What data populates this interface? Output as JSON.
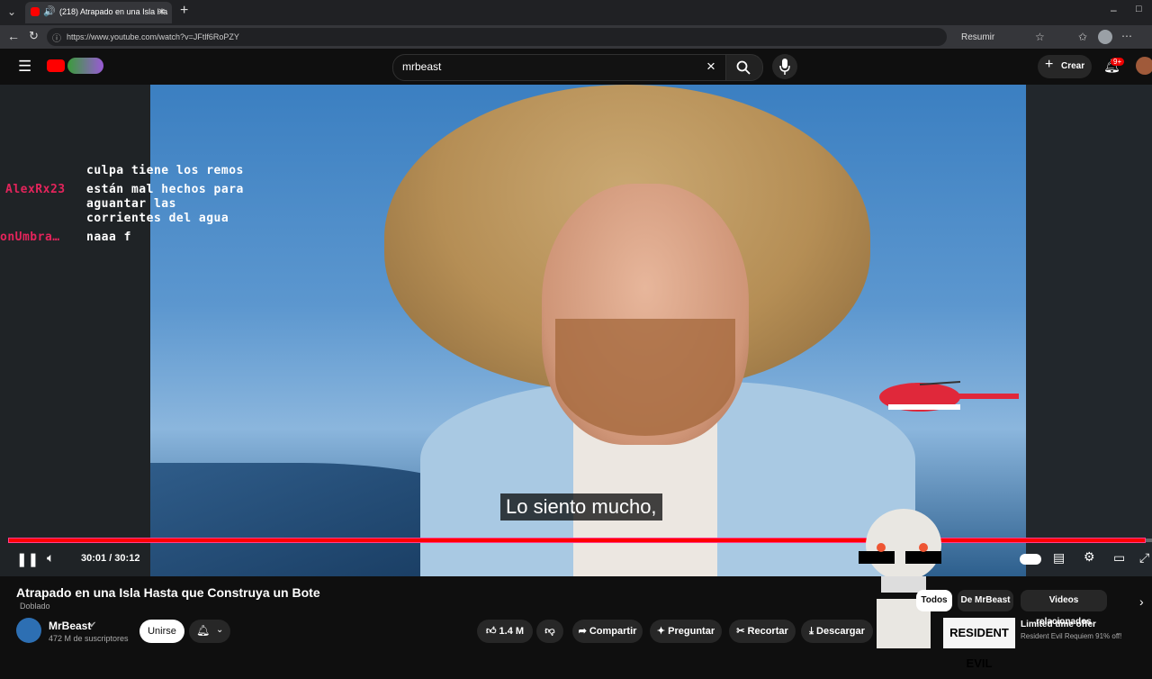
{
  "browser": {
    "tab_title": "(218) Atrapado en una Isla Ha",
    "url": "https://www.youtube.com/watch?v=JFtlf6RoPZY",
    "resumir_label": "Resumir"
  },
  "header": {
    "search_value": "mrbeast",
    "create_label": "Crear",
    "notifications_badge": "9+"
  },
  "player": {
    "chat": [
      {
        "name": "",
        "text": "culpa tiene los remos"
      },
      {
        "name": "AlexRx23",
        "text": "están mal hechos para"
      },
      {
        "name": "",
        "text": "aguantar las"
      },
      {
        "name": "",
        "text": "corrientes del agua"
      },
      {
        "name": "onUmbra…",
        "text": "naaa f"
      }
    ],
    "subtitle": "Lo siento mucho,",
    "time": "30:01 / 30:12",
    "progress_fraction": 0.994
  },
  "video": {
    "title": "Atrapado en una Isla Hasta que Construya un Bote",
    "dub_label": "Doblado",
    "channel": "MrBeast",
    "subscribers": "472 M de suscriptores",
    "join_label": "Unirse",
    "likes": "1.4 M",
    "share_label": "Compartir",
    "ask_label": "Preguntar",
    "clip_label": "Recortar",
    "download_label": "Descargar"
  },
  "chips": [
    "Todos",
    "De MrBeast",
    "Videos relacionados"
  ],
  "ad": {
    "thumb_text": "RESIDENT EVIL",
    "title": "Limited time offer",
    "subtitle": "Resident Evil Requiem 91% off!"
  }
}
